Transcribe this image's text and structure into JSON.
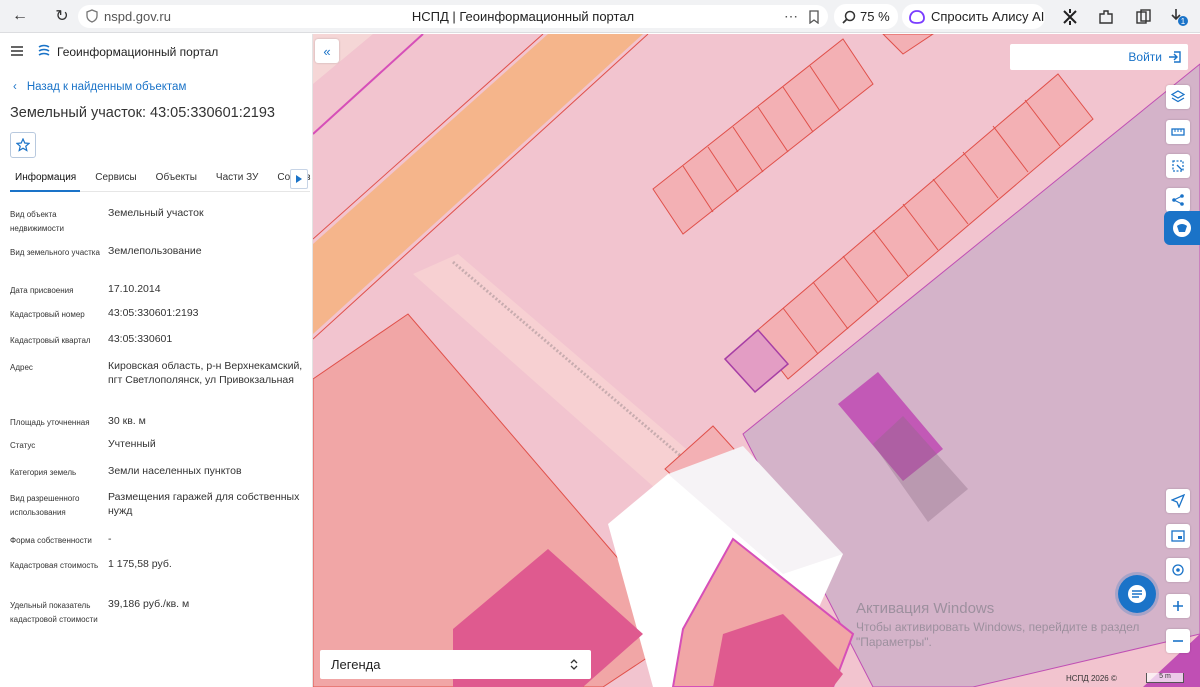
{
  "browser": {
    "url": "nspd.gov.ru",
    "tab_title": "НСПД | Геоинформационный портал",
    "zoom": "75 %",
    "alice_label": "Спросить Алису AI",
    "notification_count": "1"
  },
  "sidebar": {
    "portal_title": "Геоинформационный портал",
    "back_link": "Назад к найденным объектам",
    "object_title": "Земельный участок: 43:05:330601:2193",
    "tabs": [
      {
        "label": "Информация"
      },
      {
        "label": "Сервисы"
      },
      {
        "label": "Объекты"
      },
      {
        "label": "Части ЗУ"
      },
      {
        "label": "Состав"
      }
    ],
    "properties": [
      {
        "label": "Вид объекта недвижимости",
        "value": "Земельный участок"
      },
      {
        "label": "Вид земельного участка",
        "value": "Землепользование"
      },
      {
        "label": "Дата присвоения",
        "value": "17.10.2014"
      },
      {
        "label": "Кадастровый номер",
        "value": "43:05:330601:2193"
      },
      {
        "label": "Кадастровый квартал",
        "value": "43:05:330601"
      },
      {
        "label": "Адрес",
        "value": "Кировская область, р-н Верхнекамский, пгт Светлополянск, ул Привокзальная"
      },
      {
        "label": "Площадь уточненная",
        "value": "30 кв. м"
      },
      {
        "label": "Статус",
        "value": "Учтенный"
      },
      {
        "label": "Категория земель",
        "value": "Земли населенных пунктов"
      },
      {
        "label": "Вид разрешенного использования",
        "value": "Размещения гаражей для собственных нужд"
      },
      {
        "label": "Форма собственности",
        "value": "-"
      },
      {
        "label": "Кадастровая стоимость",
        "value": "1 175,58 руб."
      },
      {
        "label": "Удельный показатель кадастровой стоимости",
        "value": "39,186 руб./кв. м"
      }
    ]
  },
  "map": {
    "login_label": "Войти",
    "legend_label": "Легенда",
    "copyright": "НСПД 2026 ©",
    "scale_label": "5 m",
    "watermark_title": "Активация Windows",
    "watermark_sub": "Чтобы активировать Windows, перейдите в раздел \"Параметры\"."
  },
  "colors": {
    "accent": "#1a73c8",
    "parcel_fill": "#f2c4cf",
    "parcel_stroke": "#e0504a",
    "highlight": "#c04fb4",
    "orange_road": "#f2a46a",
    "purple_zone": "#d4b3c9"
  }
}
